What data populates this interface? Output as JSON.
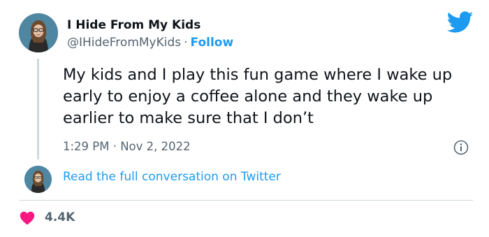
{
  "author": {
    "name": "I Hide From My Kids",
    "handle": "@IHideFromMyKids",
    "separator": "·",
    "follow_label": "Follow"
  },
  "tweet": {
    "text": "My kids and I play this fun game where I wake up early to enjoy a coffee alone and they wake up earlier to make sure that I don’t",
    "timestamp": "1:29 PM · Nov 2, 2022"
  },
  "conversation": {
    "link_label": "Read the full conversation on Twitter"
  },
  "engagement": {
    "likes": "4.4K"
  },
  "colors": {
    "brand_blue": "#1d9bf0",
    "like_red": "#f91880",
    "secondary_text": "#536471"
  },
  "icons": {
    "logo": "twitter-bird-icon",
    "info": "info-icon",
    "like": "heart-icon"
  }
}
